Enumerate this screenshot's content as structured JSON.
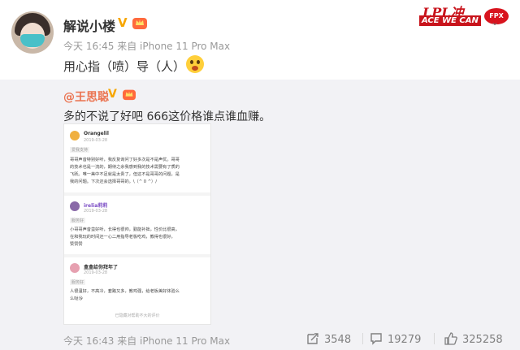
{
  "post": {
    "author": "解说小楼",
    "vip_mark": "V",
    "time": "今天 16:45",
    "source": "来自 iPhone 11 Pro Max",
    "content": "用心指（喷）导（人）",
    "banner": {
      "line1": "LPL冲",
      "line2": "ACE WE CAN",
      "logo": "FPX"
    }
  },
  "repost": {
    "author": "@王思聪",
    "vip_mark": "V",
    "content": "多的不说了好吧 666这价格谁点谁血赚。",
    "screenshot": {
      "review1": {
        "name": "Orangelil",
        "date": "2019-03-28",
        "tag": "爱我支持",
        "lines": [
          "哥哥声音特别好听，我反复询问了好多次是不是声优。哥哥",
          "的技术也是一流的，期待之余我感到我的技术需要有了质的",
          "飞跃。唯一美中不足就是太贵了，但这不是哥哥的问题，是",
          "我的问题。下次还会选择哥哥的。\\（^ 0 ^）/"
        ]
      },
      "review2": {
        "name": "irelia莉莉",
        "date": "2019-03-28",
        "tag": "服务好",
        "lines": [
          "小哥哥声音蛮好听，长得也很帅，勤能补拙，性价比很高，",
          "在和我玩的时间还一心二用指导老板吃鸡，教得也很好，",
          "赞赞赞"
        ]
      },
      "review3": {
        "name": "盒盒给你拜年了",
        "date": "2019-03-28",
        "tag": "服务好",
        "lines": [
          "人很温好，不高冷，套路又多，教鸡强，给老板美好体验么",
          "么哒😘"
        ]
      },
      "footer": "已隐藏对帮助不大的评价"
    },
    "time": "今天 16:43",
    "source": "来自 iPhone 11 Pro Max",
    "reposts": "3548",
    "comments": "19279",
    "likes": "325258"
  },
  "colors": {
    "link": "#eb7350",
    "vip": "#f7a600",
    "muted": "#999999",
    "repost_bg": "#f2f2f5"
  },
  "icons": [
    "chevron-down-icon",
    "repost-icon",
    "comment-icon",
    "like-icon",
    "crown-icon",
    "surprised-emoji-icon"
  ]
}
